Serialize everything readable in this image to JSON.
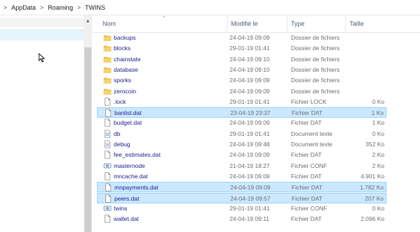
{
  "breadcrumb": {
    "items": [
      "AppData",
      "Roaming",
      "TWINS"
    ],
    "separator": ">"
  },
  "columns": {
    "name": "Nom",
    "modified": "Modifié le",
    "type": "Type",
    "size": "Taille"
  },
  "colors": {
    "selection_bg": "#cce8ff",
    "selection_border": "#99d1ff",
    "folder": "#e8b830",
    "nav_selected": "#e5f3fb"
  },
  "files": [
    {
      "name": "backups",
      "modified": "24-04-19 09:09",
      "type": "Dossier de fichiers",
      "size": "",
      "icon": "folder-icon",
      "selected": false
    },
    {
      "name": "blocks",
      "modified": "29-01-19 01:41",
      "type": "Dossier de fichiers",
      "size": "",
      "icon": "folder-icon",
      "selected": false
    },
    {
      "name": "chainstate",
      "modified": "24-04-19 09:10",
      "type": "Dossier de fichiers",
      "size": "",
      "icon": "folder-icon",
      "selected": false
    },
    {
      "name": "database",
      "modified": "24-04-19 09:10",
      "type": "Dossier de fichiers",
      "size": "",
      "icon": "folder-icon",
      "selected": false
    },
    {
      "name": "sporks",
      "modified": "24-04-19 09:09",
      "type": "Dossier de fichiers",
      "size": "",
      "icon": "folder-icon",
      "selected": false
    },
    {
      "name": "zerocoin",
      "modified": "24-04-19 09:09",
      "type": "Dossier de fichiers",
      "size": "",
      "icon": "folder-icon",
      "selected": false
    },
    {
      "name": ".lock",
      "modified": "29-01-19 01:41",
      "type": "Fichier LOCK",
      "size": "0 Ko",
      "icon": "file-icon",
      "selected": false
    },
    {
      "name": "banlist.dat",
      "modified": "23-04-19 23:37",
      "type": "Fichier DAT",
      "size": "1 Ko",
      "icon": "file-icon",
      "selected": true
    },
    {
      "name": "budget.dat",
      "modified": "24-04-19 09:09",
      "type": "Fichier DAT",
      "size": "1 Ko",
      "icon": "file-icon",
      "selected": false
    },
    {
      "name": "db",
      "modified": "29-01-19 01:41",
      "type": "Document texte",
      "size": "0 Ko",
      "icon": "text-file-icon",
      "selected": false
    },
    {
      "name": "debug",
      "modified": "24-04-19 09:48",
      "type": "Document texte",
      "size": "352 Ko",
      "icon": "text-file-icon",
      "selected": false
    },
    {
      "name": "fee_estimates.dat",
      "modified": "24-04-19 09:09",
      "type": "Fichier DAT",
      "size": "2 Ko",
      "icon": "file-icon",
      "selected": false
    },
    {
      "name": "masternode",
      "modified": "21-04-19 18:27",
      "type": "Fichier CONF",
      "size": "2 Ko",
      "icon": "config-file-icon",
      "selected": false
    },
    {
      "name": "mncache.dat",
      "modified": "24-04-19 09:09",
      "type": "Fichier DAT",
      "size": "4.901 Ko",
      "icon": "file-icon",
      "selected": false
    },
    {
      "name": "mnpayments.dat",
      "modified": "24-04-19 09:09",
      "type": "Fichier DAT",
      "size": "1.782 Ko",
      "icon": "file-icon",
      "selected": true
    },
    {
      "name": "peers.dat",
      "modified": "24-04-19 09:57",
      "type": "Fichier DAT",
      "size": "207 Ko",
      "icon": "file-icon",
      "selected": true
    },
    {
      "name": "twins",
      "modified": "29-01-19 01:41",
      "type": "Fichier CONF",
      "size": "0 Ko",
      "icon": "config-file-icon",
      "selected": false
    },
    {
      "name": "wallet.dat",
      "modified": "24-04-19 09:11",
      "type": "Fichier DAT",
      "size": "2.096 Ko",
      "icon": "file-icon",
      "selected": false
    }
  ]
}
